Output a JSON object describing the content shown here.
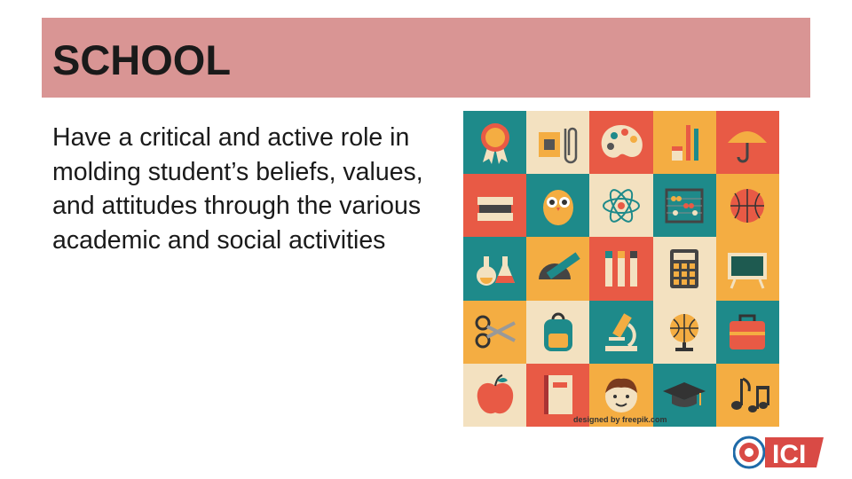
{
  "slide": {
    "title": "SCHOOL",
    "body": "Have a critical and active role in molding student’s beliefs, values, and attitudes through the various academic and social activities"
  },
  "illustration": {
    "credit": "designed by  freepik.com",
    "tiles": [
      {
        "icon": "award-ribbon-icon",
        "bg": "#1e8a8a"
      },
      {
        "icon": "sharpener-paperclip-icon",
        "bg": "#f3e1c0"
      },
      {
        "icon": "paint-palette-icon",
        "bg": "#e85a45"
      },
      {
        "icon": "pencils-eraser-icon",
        "bg": "#f4ad42"
      },
      {
        "icon": "umbrella-icon",
        "bg": "#e85a45"
      },
      {
        "icon": "books-stack-icon",
        "bg": "#e85a45"
      },
      {
        "icon": "owl-icon",
        "bg": "#1e8a8a"
      },
      {
        "icon": "atom-icon",
        "bg": "#f3e1c0"
      },
      {
        "icon": "abacus-icon",
        "bg": "#1e8a8a"
      },
      {
        "icon": "basketball-icon",
        "bg": "#f4ad42"
      },
      {
        "icon": "flasks-icon",
        "bg": "#1e8a8a"
      },
      {
        "icon": "protractor-ruler-icon",
        "bg": "#f4ad42"
      },
      {
        "icon": "markers-icon",
        "bg": "#e85a45"
      },
      {
        "icon": "calculator-icon",
        "bg": "#f3e1c0"
      },
      {
        "icon": "chalkboard-icon",
        "bg": "#f4ad42"
      },
      {
        "icon": "scissors-icon",
        "bg": "#f4ad42"
      },
      {
        "icon": "backpack-icon",
        "bg": "#f3e1c0"
      },
      {
        "icon": "microscope-icon",
        "bg": "#1e8a8a"
      },
      {
        "icon": "globe-icon",
        "bg": "#f3e1c0"
      },
      {
        "icon": "schoolbag-icon",
        "bg": "#1e8a8a"
      },
      {
        "icon": "apple-icon",
        "bg": "#f3e1c0"
      },
      {
        "icon": "notebook-icon",
        "bg": "#e85a45"
      },
      {
        "icon": "student-face-icon",
        "bg": "#f4ad42"
      },
      {
        "icon": "graduation-cap-icon",
        "bg": "#1e8a8a"
      },
      {
        "icon": "music-notes-icon",
        "bg": "#f4ad42"
      }
    ]
  },
  "logo": {
    "text": "ICI",
    "accent": "#d94a45"
  }
}
